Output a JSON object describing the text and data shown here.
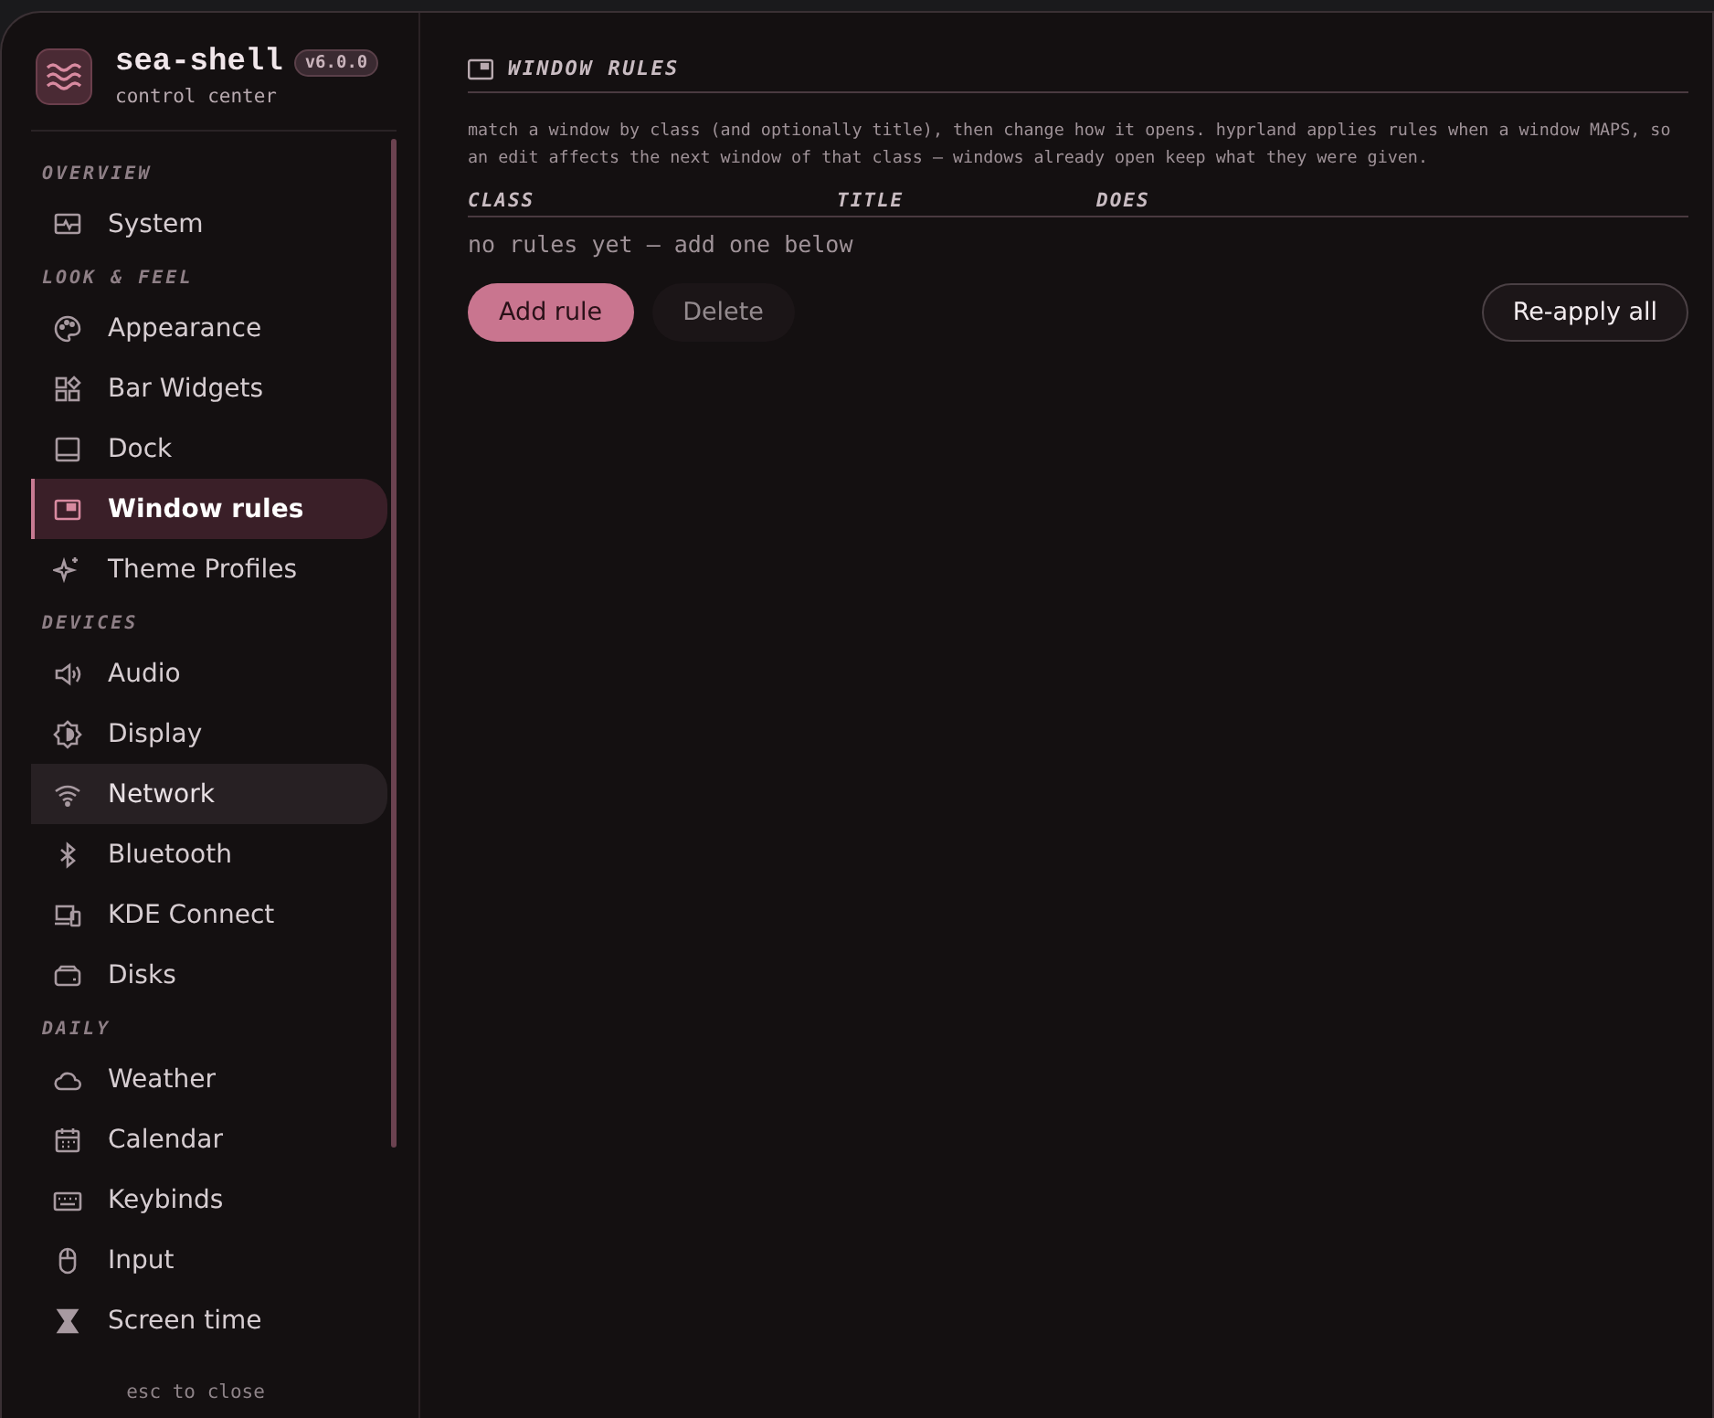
{
  "app": {
    "name": "sea-shell",
    "version": "v6.0.0",
    "subtitle": "control center"
  },
  "sidebar": {
    "sections": [
      {
        "label": "OVERVIEW",
        "items": [
          {
            "label": "System",
            "selected": false,
            "hovered": false
          }
        ]
      },
      {
        "label": "LOOK & FEEL",
        "items": [
          {
            "label": "Appearance",
            "selected": false,
            "hovered": false
          },
          {
            "label": "Bar Widgets",
            "selected": false,
            "hovered": false
          },
          {
            "label": "Dock",
            "selected": false,
            "hovered": false
          },
          {
            "label": "Window rules",
            "selected": true,
            "hovered": false
          },
          {
            "label": "Theme Profiles",
            "selected": false,
            "hovered": false
          }
        ]
      },
      {
        "label": "DEVICES",
        "items": [
          {
            "label": "Audio",
            "selected": false,
            "hovered": false
          },
          {
            "label": "Display",
            "selected": false,
            "hovered": false
          },
          {
            "label": "Network",
            "selected": false,
            "hovered": true
          },
          {
            "label": "Bluetooth",
            "selected": false,
            "hovered": false
          },
          {
            "label": "KDE Connect",
            "selected": false,
            "hovered": false
          },
          {
            "label": "Disks",
            "selected": false,
            "hovered": false
          }
        ]
      },
      {
        "label": "DAILY",
        "items": [
          {
            "label": "Weather",
            "selected": false,
            "hovered": false
          },
          {
            "label": "Calendar",
            "selected": false,
            "hovered": false
          },
          {
            "label": "Keybinds",
            "selected": false,
            "hovered": false
          },
          {
            "label": "Input",
            "selected": false,
            "hovered": false
          },
          {
            "label": "Screen time",
            "selected": false,
            "hovered": false
          }
        ]
      }
    ],
    "footer": "esc to close"
  },
  "panel": {
    "title": "WINDOW RULES",
    "description": "match a window by class (and optionally title), then change how it opens. hyprland applies rules when a window MAPS, so an edit affects the next window of that class — windows already open keep what they were given.",
    "columns": [
      "CLASS",
      "TITLE",
      "DOES"
    ],
    "empty": "no rules yet — add one below",
    "buttons": [
      {
        "label": "Add rule",
        "kind": "primary"
      },
      {
        "label": "Delete",
        "kind": "ghost"
      },
      {
        "label": "Re-apply all",
        "kind": "outline"
      }
    ]
  }
}
